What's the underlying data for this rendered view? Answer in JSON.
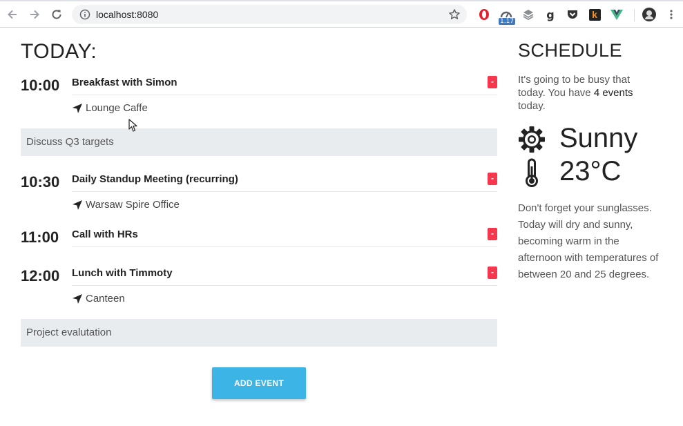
{
  "browser": {
    "url": "localhost:8080",
    "extension_badge": "1.17",
    "icons": [
      "back-icon",
      "forward-icon",
      "reload-icon",
      "info-icon",
      "star-icon",
      "opera-icon",
      "speed-icon",
      "layers-icon",
      "g-icon",
      "pocket-icon",
      "k-icon",
      "vue-icon",
      "avatar",
      "kebab-menu-icon"
    ],
    "ext_k_label": "k",
    "ext_g_label": "g"
  },
  "today": {
    "title": "TODAY:",
    "events": [
      {
        "time": "10:00",
        "title": "Breakfast with Simon",
        "location": "Lounge Caffe",
        "delete_label": "-"
      },
      {
        "time": "10:30",
        "title": "Daily Standup Meeting (recurring)",
        "location": "Warsaw Spire Office",
        "delete_label": "-"
      },
      {
        "time": "11:00",
        "title": "Call with HRs",
        "location": "",
        "delete_label": "-"
      },
      {
        "time": "12:00",
        "title": "Lunch with Timmoty",
        "location": "Canteen",
        "delete_label": "-"
      }
    ],
    "notes": [
      "Discuss Q3 targets",
      "Project evalutation"
    ],
    "add_button": "ADD EVENT"
  },
  "schedule": {
    "title": "SCHEDULE",
    "intro_before": "It's going to be busy that today. You have ",
    "intro_count": "4 events",
    "intro_after": " today.",
    "weather": {
      "condition": "Sunny",
      "temperature": "23°C"
    },
    "forecast": "Don't forget your sunglasses. Today will dry and sunny, becoming warm in the afternoon with temperatures of between 20 and 25 degrees."
  },
  "colors": {
    "accent": "#3cb4e5",
    "delete": "#f5384d",
    "note_bg": "#e9ecef"
  }
}
